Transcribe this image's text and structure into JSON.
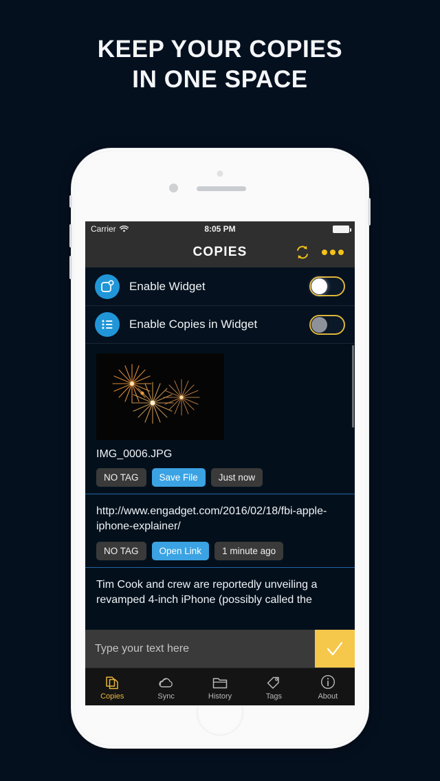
{
  "promo": {
    "headline_line1": "KEEP YOUR COPIES",
    "headline_line2": "IN ONE SPACE",
    "background_color": "#05101f",
    "headline_color": "#f4f6f8"
  },
  "status_bar": {
    "carrier": "Carrier",
    "wifi_icon": "wifi-icon",
    "time": "8:05 PM",
    "battery_icon": "battery-full-icon"
  },
  "nav_bar": {
    "title": "COPIES",
    "sync_icon": "sync-refresh-icon",
    "more_icon": "more-options-icon",
    "accent_color": "#f5c21b",
    "background_color": "#2f2f2f"
  },
  "settings": {
    "rows": [
      {
        "icon": "widget-icon",
        "label": "Enable Widget",
        "state": "on",
        "knob_color": "#ffffff"
      },
      {
        "icon": "list-icon",
        "label": "Enable Copies in Widget",
        "state": "off",
        "knob_color": "#8d9199"
      }
    ],
    "icon_bg_color": "#2096d8",
    "switch_border_color": "#e0b53a"
  },
  "clipboard_list": {
    "divider_color": "#2266a8",
    "entries": [
      {
        "type": "image",
        "thumbnail": "fireworks-photo",
        "title": "IMG_0006.JPG",
        "chips": [
          {
            "label": "NO TAG",
            "style": "default"
          },
          {
            "label": "Save File",
            "style": "action"
          },
          {
            "label": "Just now",
            "style": "default"
          }
        ]
      },
      {
        "type": "link",
        "text": "http://www.engadget.com/2016/02/18/fbi-apple-iphone-explainer/",
        "chips": [
          {
            "label": "NO TAG",
            "style": "default"
          },
          {
            "label": "Open Link",
            "style": "action"
          },
          {
            "label": "1 minute ago",
            "style": "default"
          }
        ]
      },
      {
        "type": "text",
        "text": "Tim Cook and crew are reportedly unveiling a revamped 4-inch iPhone (possibly called the",
        "chips": []
      }
    ]
  },
  "input_bar": {
    "placeholder": "Type your text here",
    "value": "",
    "send_icon": "checkmark-icon",
    "send_bg_color": "#f5c84b"
  },
  "tab_bar": {
    "active_color": "#e8b63a",
    "inactive_color": "#b9b9b9",
    "tabs": [
      {
        "label": "Copies",
        "icon": "documents-icon",
        "active": true
      },
      {
        "label": "Sync",
        "icon": "cloud-icon",
        "active": false
      },
      {
        "label": "History",
        "icon": "folder-icon",
        "active": false
      },
      {
        "label": "Tags",
        "icon": "tag-icon",
        "active": false
      },
      {
        "label": "About",
        "icon": "info-icon",
        "active": false
      }
    ]
  }
}
